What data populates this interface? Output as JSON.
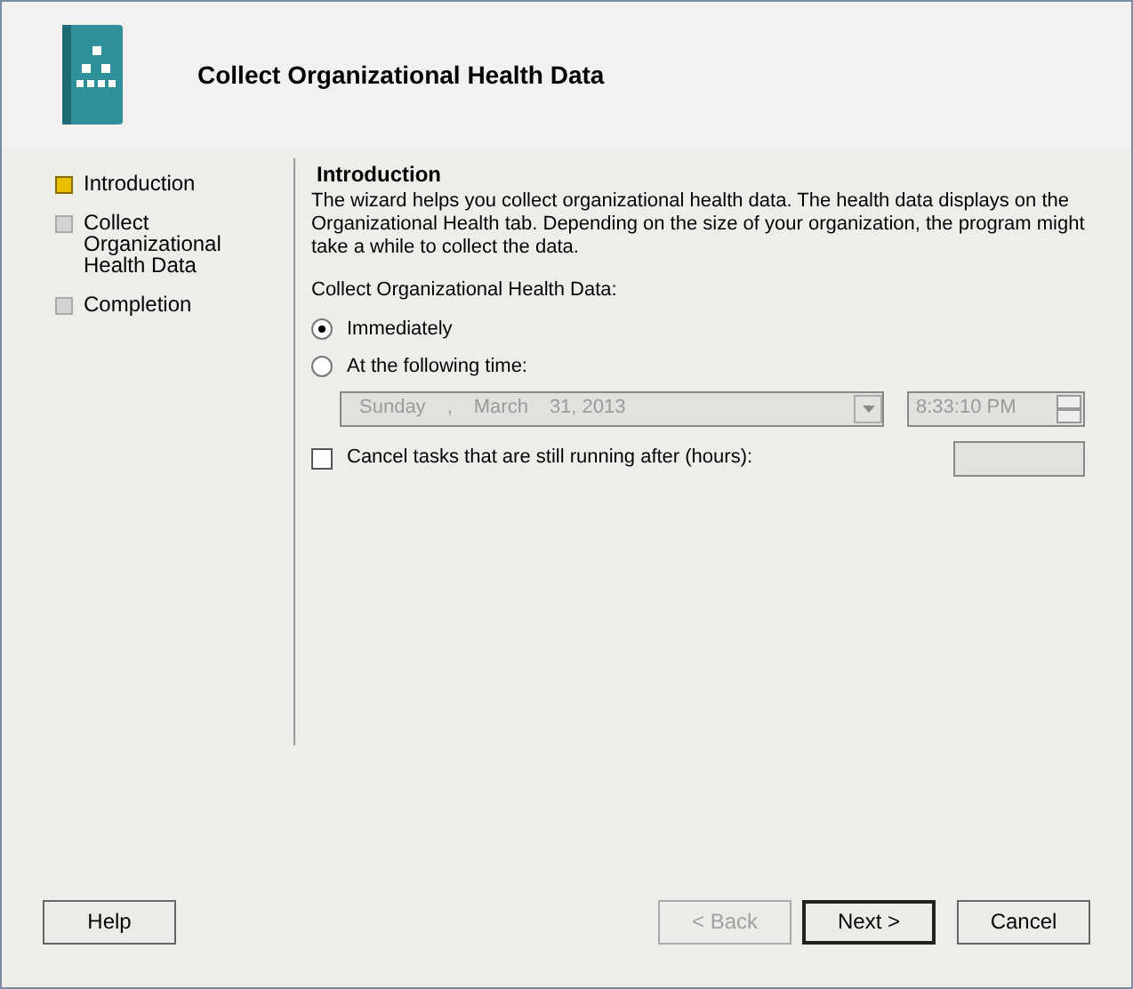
{
  "window": {
    "title": "Collect Organizational Health Data"
  },
  "steps": [
    {
      "label": "Introduction",
      "selected": true
    },
    {
      "label": "Collect Organizational Health Data",
      "selected": false
    },
    {
      "label": "Completion",
      "selected": false
    }
  ],
  "content": {
    "heading": "Introduction",
    "description": "The wizard helps you collect organizational health data. The health data displays on the Organizational Health tab. Depending on the size of your organization, the program might take a while to collect the data.",
    "schedule_label": "Collect Organizational Health Data:",
    "options": [
      {
        "label": "Immediately",
        "selected": true
      },
      {
        "label": "At the following time:",
        "selected": false
      }
    ],
    "date": {
      "weekday": "Sunday",
      "separator": ",",
      "month": "March",
      "day": "31, 2013",
      "disabled": true
    },
    "time": {
      "value": "8:33:10 PM",
      "disabled": true
    },
    "cancel_tasks": {
      "label": "Cancel tasks that are still running after (hours):",
      "checked": false
    }
  },
  "buttons": [
    {
      "label": "Help",
      "disabled": false,
      "default": false
    },
    {
      "label": "< Back",
      "disabled": true,
      "default": false
    },
    {
      "label": "Next >",
      "disabled": false,
      "default": true
    },
    {
      "label": "Cancel",
      "disabled": false,
      "default": false
    }
  ]
}
